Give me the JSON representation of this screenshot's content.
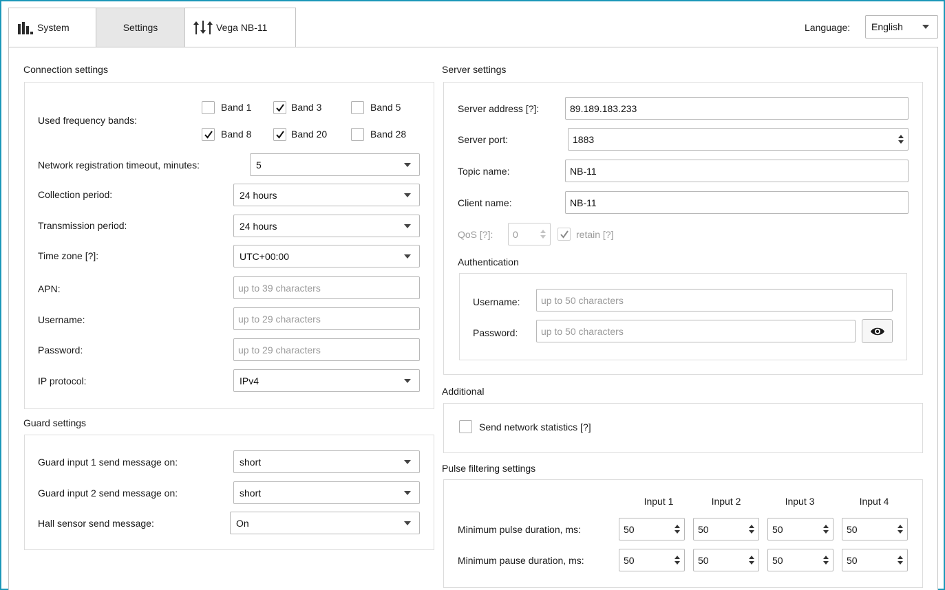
{
  "tabs": {
    "system": {
      "label": "System",
      "icon": "bar-chart-icon"
    },
    "settings": {
      "label": "Settings"
    },
    "device": {
      "label": "Vega NB-11",
      "icon": "sliders-icon"
    }
  },
  "language": {
    "label": "Language:",
    "value": "English"
  },
  "colors": {
    "accent_border": "#1b97b8",
    "active_tab": "#e7e7e7"
  },
  "connection": {
    "title": "Connection settings",
    "bands_label": "Used frequency bands:",
    "bands": [
      {
        "label": "Band 1",
        "checked": false
      },
      {
        "label": "Band 3",
        "checked": true
      },
      {
        "label": "Band 5",
        "checked": false
      },
      {
        "label": "Band 8",
        "checked": true
      },
      {
        "label": "Band 20",
        "checked": true
      },
      {
        "label": "Band 28",
        "checked": false
      }
    ],
    "reg_timeout": {
      "label": "Network registration timeout, minutes:",
      "value": "5"
    },
    "collection": {
      "label": "Collection period:",
      "value": "24 hours"
    },
    "transmission": {
      "label": "Transmission period:",
      "value": "24 hours"
    },
    "timezone": {
      "label": "Time zone [?]:",
      "value": "UTC+00:00"
    },
    "apn": {
      "label": "APN:",
      "placeholder": "up to 39 characters"
    },
    "username": {
      "label": "Username:",
      "placeholder": "up to 29 characters"
    },
    "password": {
      "label": "Password:",
      "placeholder": "up to 29 characters"
    },
    "ip_protocol": {
      "label": "IP protocol:",
      "value": "IPv4"
    }
  },
  "guard": {
    "title": "Guard settings",
    "input1": {
      "label": "Guard input 1 send message on:",
      "value": "short"
    },
    "input2": {
      "label": "Guard input 2 send message on:",
      "value": "short"
    },
    "hall": {
      "label": "Hall sensor send message:",
      "value": "On"
    }
  },
  "server": {
    "title": "Server settings",
    "address": {
      "label": "Server address [?]:",
      "value": "89.189.183.233"
    },
    "port": {
      "label": "Server port:",
      "value": "1883"
    },
    "topic": {
      "label": "Topic name:",
      "value": "NB-11"
    },
    "client": {
      "label": "Client name:",
      "value": "NB-11"
    },
    "qos": {
      "label": "QoS [?]:",
      "value": "0"
    },
    "retain": {
      "label": "retain [?]",
      "checked": true
    },
    "auth": {
      "title": "Authentication",
      "username": {
        "label": "Username:",
        "placeholder": "up to 50 characters"
      },
      "password": {
        "label": "Password:",
        "placeholder": "up to 50 characters"
      }
    }
  },
  "additional": {
    "title": "Additional",
    "net_stats": {
      "label": "Send network statistics [?]",
      "checked": false
    }
  },
  "pulse": {
    "title": "Pulse filtering settings",
    "columns": [
      "Input 1",
      "Input 2",
      "Input 3",
      "Input 4"
    ],
    "min_pulse": {
      "label": "Minimum pulse duration, ms:",
      "values": [
        "50",
        "50",
        "50",
        "50"
      ]
    },
    "min_pause": {
      "label": "Minimum pause duration, ms:",
      "values": [
        "50",
        "50",
        "50",
        "50"
      ]
    }
  }
}
